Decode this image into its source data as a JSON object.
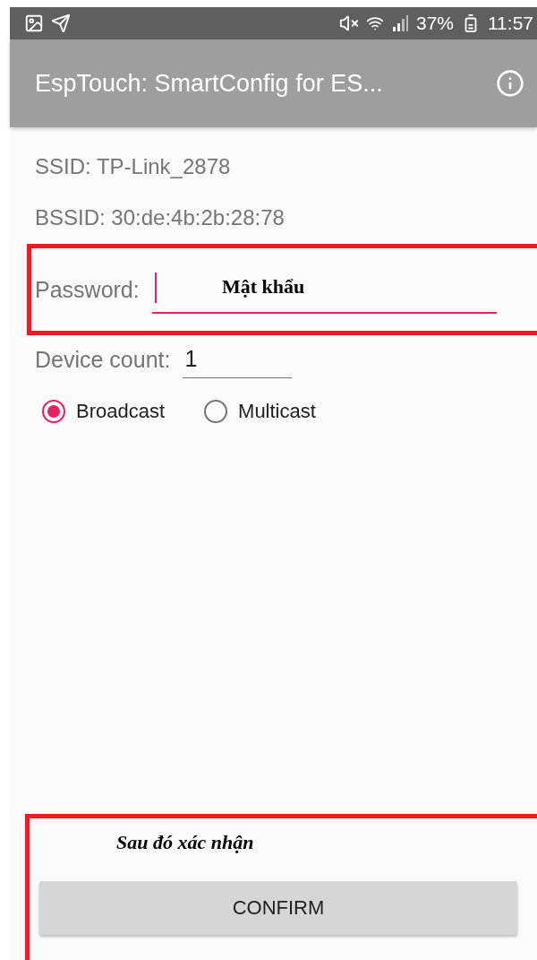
{
  "status_bar": {
    "battery": "37%",
    "time": "11:57"
  },
  "app_bar": {
    "title": "EspTouch: SmartConfig for ES..."
  },
  "info": [
    {
      "text": "SSID: TP-Link_2878"
    },
    {
      "text": "BSSID: 30:de:4b:2b:28:78"
    }
  ],
  "password": {
    "label": "Password:",
    "focused": true
  },
  "device_count": {
    "label": "Device count:",
    "value": "1"
  },
  "modes": [
    {
      "label": "Broadcast",
      "selected": true
    },
    {
      "label": "Multicast",
      "selected": false
    }
  ],
  "confirm_button": "CONFIRM",
  "annotations": [
    {
      "text": "Mật khẩu",
      "kind": "field"
    },
    {
      "text": "Sau đó xác nhận",
      "kind": "button"
    }
  ]
}
